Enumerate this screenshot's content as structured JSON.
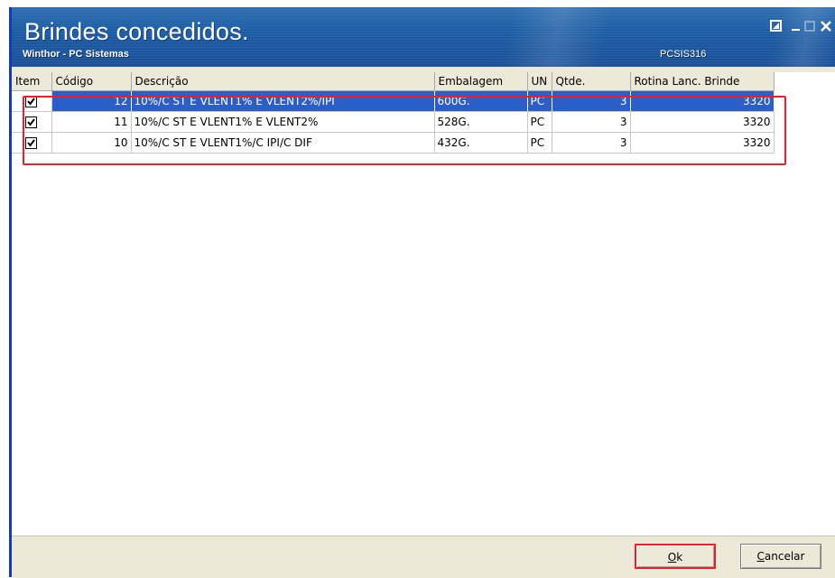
{
  "window": {
    "title": "Brindes concedidos.",
    "subtitle": "Winthor - PC Sistemas",
    "code": "PCSIS316"
  },
  "colors": {
    "selection": "#2b5fc8",
    "highlight_border": "#e8202c",
    "titlebar": "#1f5fa6"
  },
  "table": {
    "headers": [
      "Item",
      "Código",
      "Descrição",
      "Embalagem",
      "UN",
      "Qtde.",
      "Rotina Lanc. Brinde"
    ],
    "rows": [
      {
        "checked": true,
        "codigo": "12",
        "descricao": "10%/C ST E VLENT1% E VLENT2%/IPI",
        "embalagem": "600G.",
        "un": "PC",
        "qtde": "3",
        "rotina": "3320"
      },
      {
        "checked": true,
        "codigo": "11",
        "descricao": "10%/C ST E VLENT1% E VLENT2%",
        "embalagem": "528G.",
        "un": "PC",
        "qtde": "3",
        "rotina": "3320"
      },
      {
        "checked": true,
        "codigo": "10",
        "descricao": "10%/C ST E VLENT1%/C IPI/C DIF",
        "embalagem": "432G.",
        "un": "PC",
        "qtde": "3",
        "rotina": "3320"
      }
    ]
  },
  "buttons": {
    "ok_mnemonic": "O",
    "ok_rest": "k",
    "cancel_mnemonic": "C",
    "cancel_rest": "ancelar"
  }
}
